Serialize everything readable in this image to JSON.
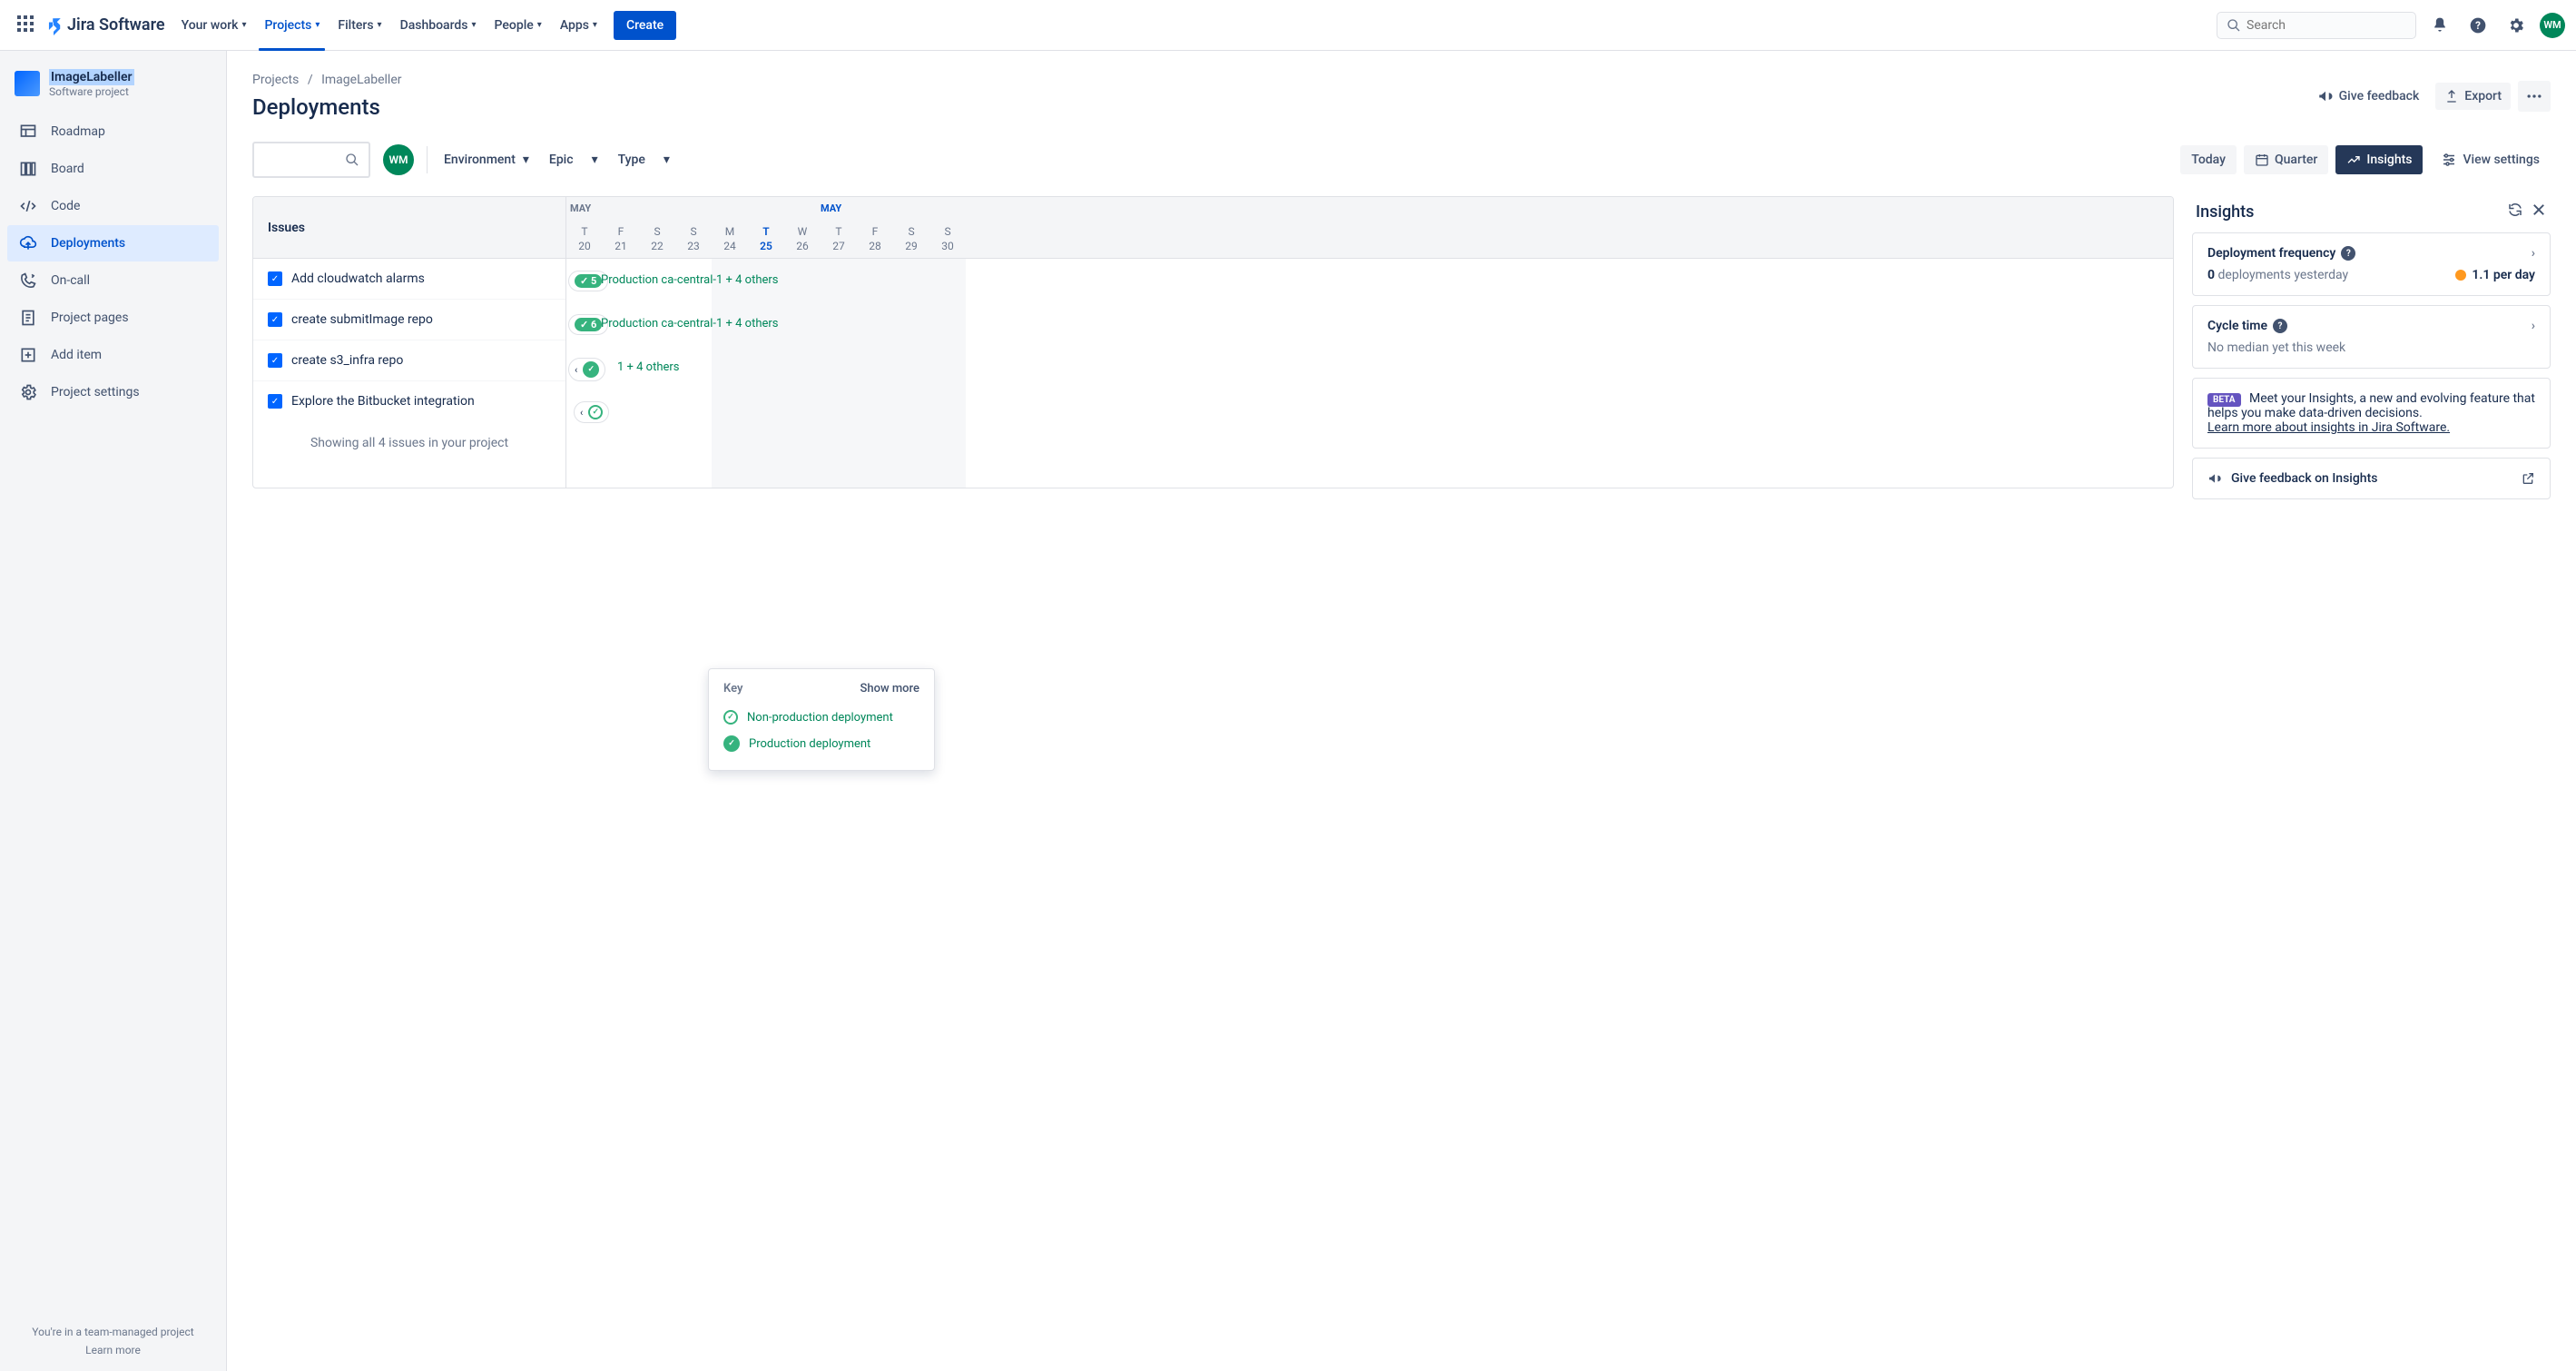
{
  "topnav": {
    "product": "Jira Software",
    "items": [
      "Your work",
      "Projects",
      "Filters",
      "Dashboards",
      "People",
      "Apps"
    ],
    "active_index": 1,
    "create": "Create",
    "search_placeholder": "Search",
    "avatar": "WM"
  },
  "sidebar": {
    "project_name": "ImageLabeller",
    "project_type": "Software project",
    "items": [
      "Roadmap",
      "Board",
      "Code",
      "Deployments",
      "On-call",
      "Project pages",
      "Add item",
      "Project settings"
    ],
    "active_index": 3,
    "footer_line1": "You're in a team-managed project",
    "footer_link": "Learn more"
  },
  "breadcrumb": {
    "a": "Projects",
    "b": "ImageLabeller"
  },
  "page_title": "Deployments",
  "title_actions": {
    "feedback": "Give feedback",
    "export": "Export"
  },
  "filters": {
    "env": "Environment",
    "epic": "Epic",
    "type": "Type",
    "today": "Today",
    "quarter": "Quarter",
    "insights": "Insights",
    "view": "View settings",
    "avatar": "WM"
  },
  "timeline": {
    "issues_label": "Issues",
    "month_a": "MAY",
    "month_b": "MAY",
    "days": [
      {
        "dow": "T",
        "num": "20"
      },
      {
        "dow": "F",
        "num": "21"
      },
      {
        "dow": "S",
        "num": "22"
      },
      {
        "dow": "S",
        "num": "23"
      },
      {
        "dow": "M",
        "num": "24"
      },
      {
        "dow": "T",
        "num": "25",
        "today": true
      },
      {
        "dow": "W",
        "num": "26"
      },
      {
        "dow": "T",
        "num": "27"
      },
      {
        "dow": "F",
        "num": "28"
      },
      {
        "dow": "S",
        "num": "29"
      },
      {
        "dow": "S",
        "num": "30"
      }
    ],
    "issues": [
      {
        "title": "Add cloudwatch alarms",
        "badge": "5",
        "text": "Production ca-central-1 + 4 others"
      },
      {
        "title": "create submitImage repo",
        "badge": "6",
        "text": "Production ca-central-1 + 4 others"
      },
      {
        "title": "create s3_infra repo",
        "text": "1 + 4 others",
        "chev": true
      },
      {
        "title": "Explore the Bitbucket integration",
        "chev": true,
        "mini": true
      }
    ],
    "footer": "Showing all 4 issues in your project"
  },
  "insights": {
    "title": "Insights",
    "freq": {
      "title": "Deployment frequency",
      "zero": "0",
      "sub_txt": " deployments yesterday",
      "rate": "1.1 per day"
    },
    "cycle": {
      "title": "Cycle time",
      "sub": "No median yet this week"
    },
    "beta": {
      "tag": "BETA",
      "text": "Meet your Insights, a new and evolving feature that helps you make data-driven decisions.",
      "link": "Learn more about insights in Jira Software."
    },
    "give_feedback": "Give feedback on Insights"
  },
  "key": {
    "label": "Key",
    "show_more": "Show more",
    "nonprod": "Non-production deployment",
    "prod": "Production deployment"
  }
}
